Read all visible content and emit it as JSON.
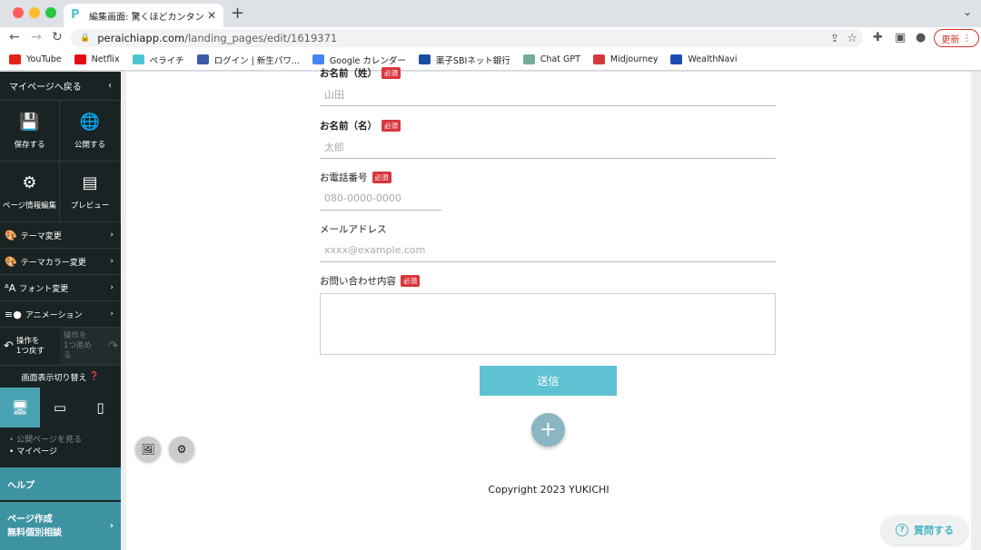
{
  "browser": {
    "tab_title": "編集画面: 驚くほどカンタン！無料",
    "url_host": "peraichiapp.com",
    "url_path": "/landing_pages/edit/1619371",
    "update_label": "更新"
  },
  "bookmarks": [
    {
      "label": "YouTube",
      "color": "#e62117"
    },
    {
      "label": "Netflix",
      "color": "#e50914"
    },
    {
      "label": "ペライチ",
      "color": "#4ec3d3"
    },
    {
      "label": "ログイン | 新生パワ...",
      "color": "#3b5ba9"
    },
    {
      "label": "Google カレンダー",
      "color": "#4285f4"
    },
    {
      "label": "薬子SBIネット銀行",
      "color": "#1a4fa0"
    },
    {
      "label": "Chat GPT",
      "color": "#74aa9c"
    },
    {
      "label": "Midjourney",
      "color": "#d3393c"
    },
    {
      "label": "WealthNavi",
      "color": "#1b4bb5"
    }
  ],
  "sidebar": {
    "back_label": "マイページへ戻る",
    "save_label": "保存する",
    "publish_label": "公開する",
    "page_info_label": "ページ情報編集",
    "preview_label": "プレビュー",
    "menu": [
      {
        "label": "テーマ変更"
      },
      {
        "label": "テーマカラー変更"
      },
      {
        "label": "フォント変更"
      },
      {
        "label": "アニメーション"
      }
    ],
    "undo_line1": "操作を",
    "undo_line2": "1つ戻す",
    "redo_line1": "操作を",
    "redo_line2": "1つ進める",
    "view_switch_label": "画面表示切り替え",
    "public_page_link": "公開ページを見る",
    "mypage_link": "マイページ",
    "help_label": "ヘルプ",
    "consult_line1": "ページ作成",
    "consult_line2": "無料個別相談"
  },
  "form": {
    "last_name_label": "お名前（姓）",
    "last_name_placeholder": "山田",
    "first_name_label": "お名前（名）",
    "first_name_placeholder": "太郎",
    "phone_label": "お電話番号",
    "phone_placeholder": "080-0000-0000",
    "email_label": "メールアドレス",
    "email_placeholder": "xxxx@example.com",
    "inquiry_label": "お問い合わせ内容",
    "required_badge": "必須",
    "submit_label": "送信"
  },
  "footer": {
    "copyright": "Copyright 2023 YUKICHI"
  },
  "help_widget": {
    "label": "質問する"
  }
}
